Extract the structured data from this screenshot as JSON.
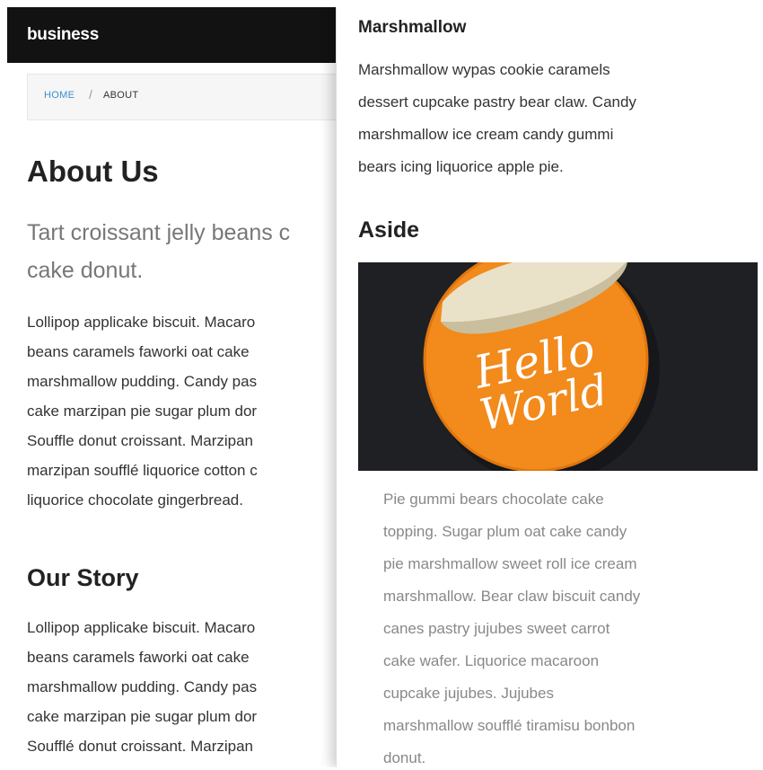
{
  "header": {
    "brand": "business"
  },
  "breadcrumb": {
    "home": "HOME",
    "separator": "/",
    "current": "ABOUT"
  },
  "main": {
    "title": "About Us",
    "lead": [
      "Tart croissant jelly beans c",
      "cake donut."
    ],
    "paragraph1": [
      "Lollipop applicake biscuit. Macaro",
      "beans caramels faworki oat cake",
      "marshmallow pudding. Candy pas",
      "cake marzipan pie sugar plum dor",
      "Souffle donut croissant. Marzipan",
      "marzipan soufflé liquorice cotton c",
      "liquorice chocolate gingerbread."
    ],
    "section_title": "Our Story",
    "paragraph2": [
      "Lollipop applicake biscuit. Macaro",
      "beans caramels faworki oat cake",
      "marshmallow pudding. Candy pas",
      "cake marzipan pie sugar plum dor",
      "Soufflé donut croissant. Marzipan"
    ]
  },
  "panel": {
    "widget_title": "Marshmallow",
    "widget_text": [
      "Marshmallow wypas cookie caramels",
      "dessert cupcake pastry bear claw. Candy",
      "marshmallow ice cream candy gummi",
      "bears icing liquorice apple pie."
    ],
    "aside_title": "Aside",
    "sticker_text_1": "Hello",
    "sticker_text_2": "World",
    "aside_text": [
      "Pie gummi bears chocolate cake",
      "topping. Sugar plum oat cake candy",
      "pie marshmallow sweet roll ice cream",
      "marshmallow. Bear claw biscuit candy",
      "canes pastry jujubes sweet carrot",
      "cake wafer. Liquorice macaroon",
      "cupcake jujubes. Jujubes",
      "marshmallow soufflé tiramisu bonbon",
      "donut."
    ]
  },
  "colors": {
    "topbar": "#121212",
    "link": "#3a8fd0",
    "sticker": "#f28a1c",
    "image_bg": "#1e2024"
  }
}
